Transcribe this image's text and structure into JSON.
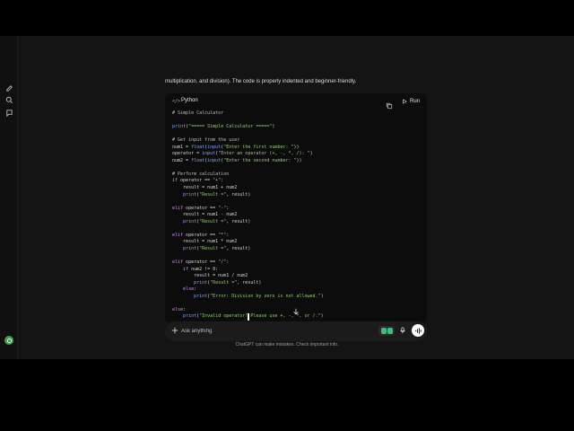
{
  "intro_text": "multiplication, and division). The code is properly indented and beginner-friendly.",
  "code_block": {
    "language_icon": "code-brackets-icon",
    "language": "Python",
    "copy_icon": "copy-icon",
    "run_label": "Run",
    "lines": [
      "# Simple Calculator",
      "",
      "print(\"===== Simple Calculator =====\")",
      "",
      "# Get input from the user",
      "num1 = float(input(\"Enter the first number: \"))",
      "operator = input(\"Enter an operator (+, -, *, /): \")",
      "num2 = float(input(\"Enter the second number: \"))",
      "",
      "# Perform calculation",
      "if operator == \"+\":",
      "    result = num1 + num2",
      "    print(\"Result =\", result)",
      "",
      "elif operator == \"-\":",
      "    result = num1 - num2",
      "    print(\"Result =\", result)",
      "",
      "elif operator == \"*\":",
      "    result = num1 * num2",
      "    print(\"Result =\", result)",
      "",
      "elif operator == \"/\":",
      "    if num2 != 0:",
      "        result = num1 / num2",
      "        print(\"Result =\", result)",
      "    else:",
      "        print(\"Error: Division by zero is not allowed.\")",
      "",
      "else:",
      "    print(\"Invalid operator! Please use +, -, *, or /.\")"
    ]
  },
  "composer": {
    "placeholder": "Ask anything",
    "value": ""
  },
  "disclaimer": "ChatGPT can make mistakes. Check important info.",
  "sidebar_icons": [
    "new-chat-icon",
    "search-icon",
    "library-icon"
  ],
  "colors": {
    "background": "#141414",
    "code_background": "#0c0c0c",
    "string": "#8fcf6e",
    "function": "#7fa8ff",
    "keyword": "#c792ea",
    "avatar": "#3fa34d",
    "tools_badge": "#39c37a"
  }
}
